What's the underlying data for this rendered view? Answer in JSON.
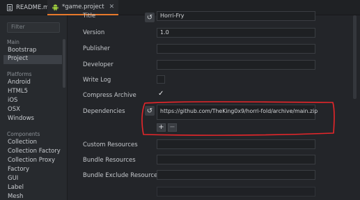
{
  "tabs": [
    {
      "label": "README.md",
      "active": false
    },
    {
      "label": "*game.project",
      "active": true
    }
  ],
  "sidebar": {
    "filter_placeholder": "Filter",
    "sections": [
      {
        "title": "Main",
        "items": [
          "Bootstrap",
          "Project"
        ]
      },
      {
        "title": "Platforms",
        "items": [
          "Android",
          "HTML5",
          "iOS",
          "OSX",
          "Windows"
        ]
      },
      {
        "title": "Components",
        "items": [
          "Collection",
          "Collection Factory",
          "Collection Proxy",
          "Factory",
          "GUI",
          "Label",
          "Mesh"
        ]
      }
    ],
    "selected": "Project"
  },
  "form": {
    "title_label": "Title",
    "title_value": "Horri-Fry",
    "version_label": "Version",
    "version_value": "1.0",
    "publisher_label": "Publisher",
    "publisher_value": "",
    "developer_label": "Developer",
    "developer_value": "",
    "write_log_label": "Write Log",
    "write_log_checked": false,
    "compress_archive_label": "Compress Archive",
    "compress_archive_checked": true,
    "dependencies_label": "Dependencies",
    "dependencies": [
      "https://github.com/TheKing0x9/horri-fold/archive/main.zip"
    ],
    "add_symbol": "+",
    "remove_symbol": "−",
    "custom_resources_label": "Custom Resources",
    "bundle_resources_label": "Bundle Resources",
    "bundle_exclude_resources_label": "Bundle Exclude Resources"
  },
  "colors": {
    "accent_tab": "#e8792b",
    "annotation": "#e8262a",
    "android_icon": "#9bc93d"
  },
  "icons": {
    "reset": "reset-icon",
    "checkmark": "checkmark-icon",
    "android": "android-icon",
    "file": "file-icon"
  }
}
